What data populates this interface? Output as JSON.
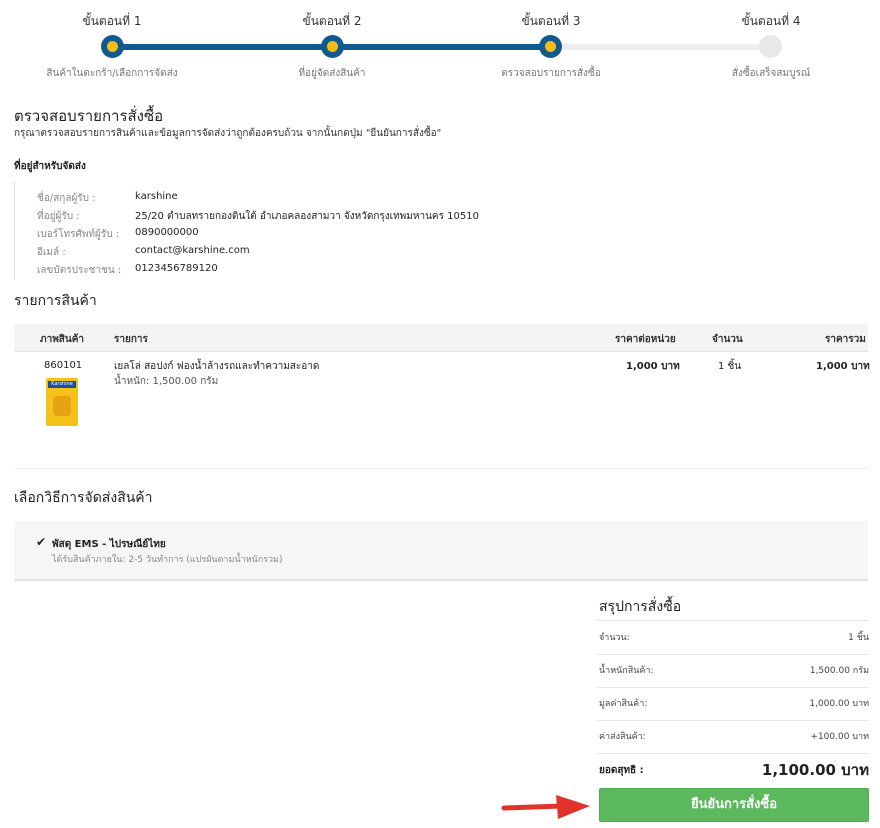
{
  "stepper": {
    "steps": [
      {
        "title": "ขั้นตอนที่ 1",
        "subtitle": "สินค้าในตะกร้า/เลือกการจัดส่ง",
        "state": "done"
      },
      {
        "title": "ขั้นตอนที่ 2",
        "subtitle": "ที่อยู่จัดส่งสินค้า",
        "state": "done"
      },
      {
        "title": "ขั้นตอนที่ 3",
        "subtitle": "ตรวจสอบรายการสั่งซื้อ",
        "state": "current"
      },
      {
        "title": "ขั้นตอนที่ 4",
        "subtitle": "สั่งซื้อเสร็จสมบูรณ์",
        "state": "todo"
      }
    ]
  },
  "review": {
    "title": "ตรวจสอบรายการสั่งซื้อ",
    "description": "กรุณาตรวจสอบรายการสินค้าและข้อมูลการจัดส่งว่าถูกต้องครบถ้วน จากนั้นกดปุ่ม \"ยืนยันการสั่งซื้อ\""
  },
  "shipping_address": {
    "title": "ที่อยู่สำหรับจัดส่ง",
    "rows": [
      {
        "label": "ชื่อ/สกุลผู้รับ :",
        "value": "karshine"
      },
      {
        "label": "ที่อยู่ผู้รับ :",
        "value": "25/20 ตำบลทรายกองดินใต้ อำเภอคลองสามวา จังหวัดกรุงเทพมหานคร 10510"
      },
      {
        "label": "เบอร์โทรศัพท์ผู้รับ :",
        "value": "0890000000"
      },
      {
        "label": "อีเมล์ :",
        "value": "contact@karshine.com"
      },
      {
        "label": "เลขบัตรประชาชน :",
        "value": "0123456789120"
      }
    ]
  },
  "products": {
    "title": "รายการสินค้า",
    "columns": {
      "image": "ภาพสินค้า",
      "item": "รายการ",
      "unit_price": "ราคาต่อหน่วย",
      "qty": "จำนวน",
      "total": "ราคารวม"
    },
    "rows": [
      {
        "sku": "860101",
        "image_label": "Karshine",
        "name": "เยลโล่ สอปงก์ ฟองน้ำล้างรถและทำความสะอาด",
        "weight": "น้ำหนัก: 1,500.00 กรัม",
        "unit_price": "1,000 บาท",
        "qty": "1 ชิ้น",
        "total": "1,000 บาท"
      }
    ]
  },
  "shipping_method": {
    "title": "เลือกวิธีการจัดส่งสินค้า",
    "check_icon": "check-icon",
    "name": "พัสดุ EMS - ไปรษณีย์ไทย",
    "description": "ได้รับสินค้าภายใน: 2-5 วันทำการ (แปรผันตามน้ำหนักรวม)"
  },
  "summary": {
    "title": "สรุปการสั่งซื้อ",
    "rows": [
      {
        "label": "จำนวน:",
        "value": "1 ชิ้น"
      },
      {
        "label": "น้ำหนักสินค้า:",
        "value": "1,500.00 กรัม"
      },
      {
        "label": "มูลค่าสินค้า:",
        "value": "1,000.00 บาท"
      },
      {
        "label": "ค่าส่งสินค้า:",
        "value": "+100.00 บาท"
      }
    ],
    "total_label": "ยอดสุทธิ :",
    "total_value": "1,100.00 บาท"
  },
  "confirm_button": {
    "label": "ยืนยันการสั่งซื้อ"
  },
  "colors": {
    "primary": "#115a8f",
    "accent": "#f3bd16",
    "success": "#5cb85c",
    "arrow": "#e0342b"
  }
}
